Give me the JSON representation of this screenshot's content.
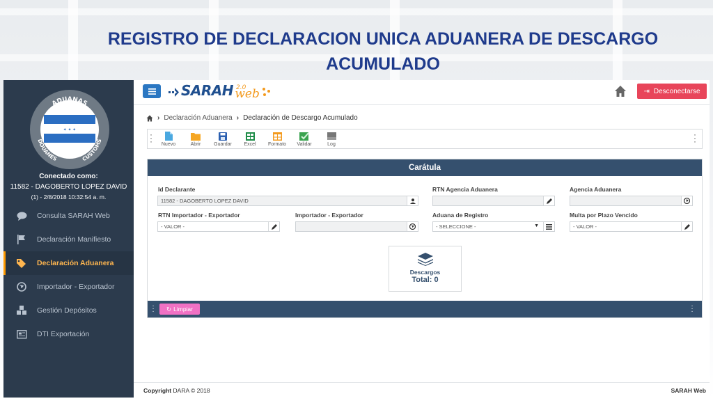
{
  "slide": {
    "title_line1": "REGISTRO DE DECLARACION UNICA ADUANERA DE DESCARGO",
    "title_line2": "ACUMULADO"
  },
  "logo": {
    "top_text": "ADUANAS",
    "left_text": "DOUANES",
    "right_text": "CUSTOMS"
  },
  "user": {
    "connected_label": "Conectado como:",
    "name": "11582 - DAGOBERTO LOPEZ DAVID",
    "session": "(1) - 2/8/2018 10:32:54 a. m."
  },
  "sidebar": {
    "items": [
      {
        "label": "Consulta SARAH Web",
        "icon": "chat-icon"
      },
      {
        "label": "Declaración Manifiesto",
        "icon": "flag-icon"
      },
      {
        "label": "Declaración Aduanera",
        "icon": "tags-icon",
        "active": true
      },
      {
        "label": "Importador - Exportador",
        "icon": "globe-icon"
      },
      {
        "label": "Gestión Depósitos",
        "icon": "cubes-icon"
      },
      {
        "label": "DTI Exportación",
        "icon": "document-icon"
      }
    ]
  },
  "header": {
    "brand_name": "SARAH",
    "brand_version": "2.0",
    "brand_web": "web",
    "logout_label": "Desconectarse"
  },
  "breadcrumb": {
    "parent": "Declaración Aduanera",
    "current": "Declaración de Descargo Acumulado"
  },
  "toolbar": {
    "items": [
      {
        "label": "Nuevo",
        "icon": "new-file-icon"
      },
      {
        "label": "Abrir",
        "icon": "folder-icon"
      },
      {
        "label": "Guardar",
        "icon": "save-icon"
      },
      {
        "label": "Excel",
        "icon": "excel-icon"
      },
      {
        "label": "Formato",
        "icon": "table-format-icon"
      },
      {
        "label": "Validar",
        "icon": "validate-icon"
      },
      {
        "label": "Log",
        "icon": "log-icon"
      }
    ]
  },
  "panel": {
    "title": "Carátula",
    "fields": {
      "id_declarante": {
        "label": "Id Declarante",
        "value": "11582 - DAGOBERTO LOPEZ DAVID"
      },
      "rtn_agencia": {
        "label": "RTN Agencia Aduanera",
        "value": ""
      },
      "agencia": {
        "label": "Agencia Aduanera",
        "value": ""
      },
      "rtn_importador": {
        "label": "RTN Importador - Exportador",
        "placeholder": "- VALOR -"
      },
      "importador": {
        "label": "Importador - Exportador",
        "value": ""
      },
      "aduana_registro": {
        "label": "Aduana de Registro",
        "value": "- SELECCIONE -"
      },
      "multa": {
        "label": "Multa por Plazo Vencido",
        "placeholder": "- VALOR -"
      }
    },
    "card": {
      "title": "Descargos",
      "total": "Total: 0"
    },
    "clear_label": "Limpiar"
  },
  "footer": {
    "copyright_prefix": "Copyright",
    "copyright_rest": "DARA © 2018",
    "app_name": "SARAH Web"
  },
  "colors": {
    "sidebar_bg": "#2c3b4d",
    "panel_header": "#35506e",
    "logout": "#e8455a",
    "clear": "#f171c4",
    "active_item": "#ffb64f",
    "title_blue": "#1f3b8c"
  }
}
